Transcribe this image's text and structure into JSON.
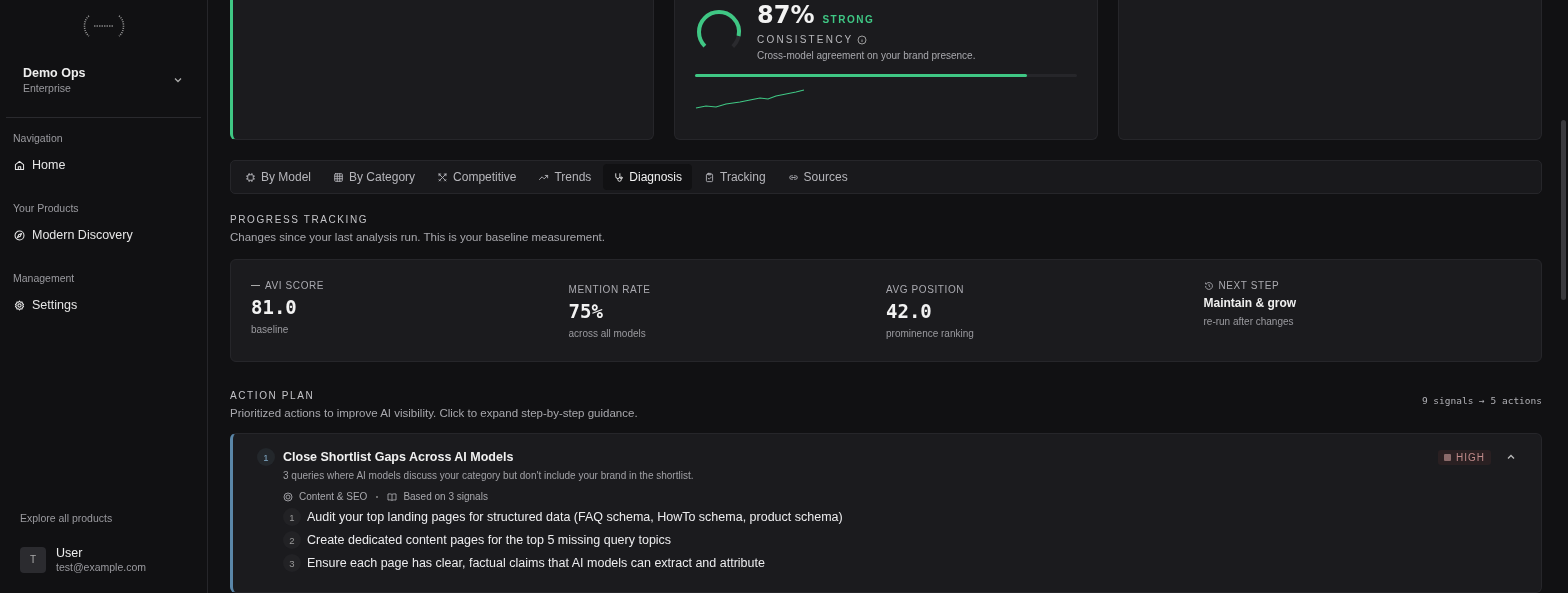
{
  "sidebar": {
    "org": {
      "name": "Demo Ops",
      "plan": "Enterprise"
    },
    "sections": [
      {
        "title": "Navigation",
        "items": [
          {
            "label": "Home"
          }
        ]
      },
      {
        "title": "Your Products",
        "items": [
          {
            "label": "Modern Discovery"
          }
        ]
      },
      {
        "title": "Management",
        "items": [
          {
            "label": "Settings"
          }
        ]
      }
    ],
    "explore": "Explore all products",
    "user": {
      "initial": "T",
      "name": "User",
      "email": "test@example.com"
    }
  },
  "consistency": {
    "value": "87%",
    "grade": "STRONG",
    "label": "CONSISTENCY",
    "description": "Cross-model agreement on your brand presence.",
    "level": 0.87
  },
  "tabs": [
    {
      "label": "By Model",
      "selected": false
    },
    {
      "label": "By Category",
      "selected": false
    },
    {
      "label": "Competitive",
      "selected": false
    },
    {
      "label": "Trends",
      "selected": false
    },
    {
      "label": "Diagnosis",
      "selected": true
    },
    {
      "label": "Tracking",
      "selected": false
    },
    {
      "label": "Sources",
      "selected": false
    }
  ],
  "progress": {
    "title": "PROGRESS TRACKING",
    "subtitle": "Changes since your last analysis run. This is your baseline measurement.",
    "stats": [
      {
        "kind": "flat",
        "label": "AVI SCORE",
        "value": "81.0",
        "note": "baseline"
      },
      {
        "kind": "metric",
        "label": "MENTION RATE",
        "value": "75%",
        "note": "across all models"
      },
      {
        "kind": "metric",
        "label": "AVG POSITION",
        "value": "42.0",
        "note": "prominence ranking"
      },
      {
        "kind": "step",
        "label": "NEXT STEP",
        "value": "Maintain & grow",
        "note": "re-run after changes"
      }
    ]
  },
  "action_plan": {
    "title": "ACTION PLAN",
    "subtitle": "Prioritized actions to improve AI visibility. Click to expand step-by-step guidance.",
    "summary": "9 signals → 5 actions",
    "actions": [
      {
        "number": "1",
        "title": "Close Shortlist Gaps Across AI Models",
        "description": "3 queries where AI models discuss your category but don't include your brand in the shortlist.",
        "category": "Content & SEO",
        "basis": "Based on 3 signals",
        "priority": "HIGH",
        "expanded": true,
        "steps": [
          {
            "number": "1",
            "text": "Audit your top landing pages for structured data (FAQ schema, HowTo schema, product schema)"
          },
          {
            "number": "2",
            "text": "Create dedicated content pages for the top 5 missing query topics"
          },
          {
            "number": "3",
            "text": "Ensure each page has clear, factual claims that AI models can extract and attribute"
          }
        ]
      }
    ]
  }
}
